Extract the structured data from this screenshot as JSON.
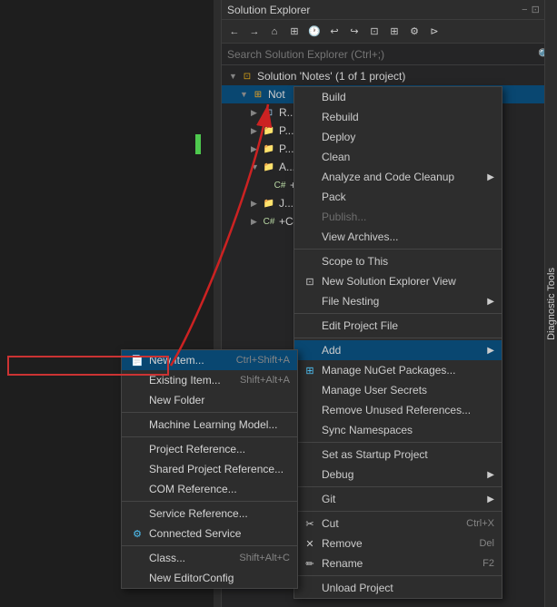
{
  "solution_explorer": {
    "title": "Solution Explorer",
    "search_placeholder": "Search Solution Explorer (Ctrl+;)",
    "solution_label": "Solution 'Notes' (1 of 1 project)",
    "project_node": "Not",
    "toolbar_buttons": [
      "←",
      "→",
      "⌂",
      "⊞",
      "🕐",
      "↩",
      "↪",
      "⊡",
      "⊞",
      "✏",
      "⚙",
      "⊳"
    ],
    "title_icons": [
      "−",
      "□",
      "⊡",
      "✕"
    ]
  },
  "context_menu_main": {
    "items": [
      {
        "label": "Build",
        "icon": "",
        "shortcut": "",
        "arrow": false,
        "separator_after": false,
        "disabled": false
      },
      {
        "label": "Rebuild",
        "icon": "",
        "shortcut": "",
        "arrow": false,
        "separator_after": false,
        "disabled": false
      },
      {
        "label": "Deploy",
        "icon": "",
        "shortcut": "",
        "arrow": false,
        "separator_after": false,
        "disabled": false
      },
      {
        "label": "Clean",
        "icon": "",
        "shortcut": "",
        "arrow": false,
        "separator_after": false,
        "disabled": false
      },
      {
        "label": "Analyze and Code Cleanup",
        "icon": "",
        "shortcut": "",
        "arrow": true,
        "separator_after": false,
        "disabled": false
      },
      {
        "label": "Pack",
        "icon": "",
        "shortcut": "",
        "arrow": false,
        "separator_after": false,
        "disabled": false
      },
      {
        "label": "Publish...",
        "icon": "",
        "shortcut": "",
        "arrow": false,
        "separator_after": false,
        "disabled": true
      },
      {
        "label": "View Archives...",
        "icon": "",
        "shortcut": "",
        "arrow": false,
        "separator_after": true,
        "disabled": false
      },
      {
        "label": "Scope to This",
        "icon": "",
        "shortcut": "",
        "arrow": false,
        "separator_after": false,
        "disabled": false
      },
      {
        "label": "New Solution Explorer View",
        "icon": "⊡",
        "shortcut": "",
        "arrow": false,
        "separator_after": false,
        "disabled": false
      },
      {
        "label": "File Nesting",
        "icon": "",
        "shortcut": "",
        "arrow": true,
        "separator_after": true,
        "disabled": false
      },
      {
        "label": "Edit Project File",
        "icon": "",
        "shortcut": "",
        "arrow": false,
        "separator_after": true,
        "disabled": false
      },
      {
        "label": "Add",
        "icon": "",
        "shortcut": "",
        "arrow": true,
        "separator_after": false,
        "disabled": false,
        "active": true
      },
      {
        "label": "Manage NuGet Packages...",
        "icon": "⊞",
        "shortcut": "",
        "arrow": false,
        "separator_after": false,
        "disabled": false
      },
      {
        "label": "Manage User Secrets",
        "icon": "",
        "shortcut": "",
        "arrow": false,
        "separator_after": false,
        "disabled": false
      },
      {
        "label": "Remove Unused References...",
        "icon": "",
        "shortcut": "",
        "arrow": false,
        "separator_after": false,
        "disabled": false
      },
      {
        "label": "Sync Namespaces",
        "icon": "",
        "shortcut": "",
        "arrow": false,
        "separator_after": true,
        "disabled": false
      },
      {
        "label": "Set as Startup Project",
        "icon": "",
        "shortcut": "",
        "arrow": false,
        "separator_after": false,
        "disabled": false
      },
      {
        "label": "Debug",
        "icon": "",
        "shortcut": "",
        "arrow": true,
        "separator_after": true,
        "disabled": false
      },
      {
        "label": "Git",
        "icon": "",
        "shortcut": "",
        "arrow": true,
        "separator_after": true,
        "disabled": false
      },
      {
        "label": "Cut",
        "icon": "✂",
        "shortcut": "Ctrl+X",
        "arrow": false,
        "separator_after": false,
        "disabled": false
      },
      {
        "label": "Remove",
        "icon": "✕",
        "shortcut": "Del",
        "arrow": false,
        "separator_after": false,
        "disabled": false
      },
      {
        "label": "Rename",
        "icon": "✏",
        "shortcut": "F2",
        "arrow": false,
        "separator_after": true,
        "disabled": false
      },
      {
        "label": "Unload Project",
        "icon": "",
        "shortcut": "",
        "arrow": false,
        "separator_after": false,
        "disabled": false
      }
    ]
  },
  "submenu_add": {
    "items": [
      {
        "label": "New Item...",
        "icon": "📄",
        "shortcut": "Ctrl+Shift+A",
        "highlighted": true
      },
      {
        "label": "Existing Item...",
        "icon": "",
        "shortcut": "Shift+Alt+A"
      },
      {
        "label": "New Folder",
        "icon": "",
        "shortcut": ""
      },
      {
        "label": "",
        "separator": true
      },
      {
        "label": "Machine Learning Model...",
        "icon": "",
        "shortcut": ""
      },
      {
        "label": "",
        "separator": true
      },
      {
        "label": "Project Reference...",
        "icon": "",
        "shortcut": ""
      },
      {
        "label": "Shared Project Reference...",
        "icon": "",
        "shortcut": ""
      },
      {
        "label": "COM Reference...",
        "icon": "",
        "shortcut": ""
      },
      {
        "label": "",
        "separator": true
      },
      {
        "label": "Service Reference...",
        "icon": "",
        "shortcut": ""
      },
      {
        "label": "Connected Service",
        "icon": "⚙",
        "shortcut": ""
      },
      {
        "label": "",
        "separator": true
      },
      {
        "label": "Class...",
        "icon": "",
        "shortcut": "Shift+Alt+C"
      },
      {
        "label": "New EditorConfig",
        "icon": "",
        "shortcut": ""
      }
    ]
  },
  "diagnostic_tools": {
    "label": "Diagnostic Tools"
  }
}
